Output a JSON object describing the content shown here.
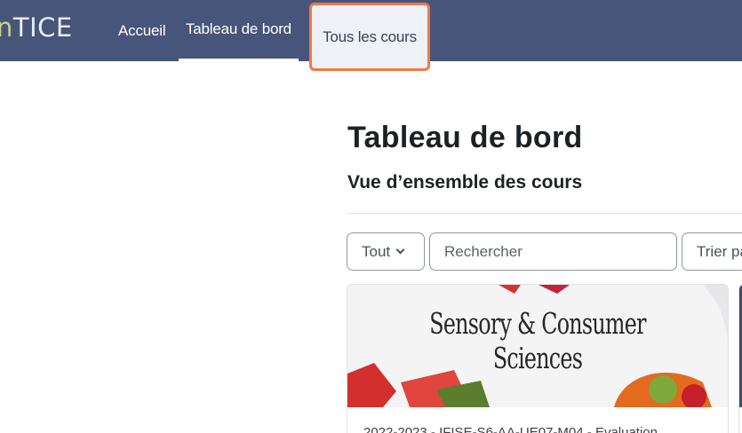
{
  "navbar": {
    "logo_prefix": "n",
    "logo_main": "TICE",
    "items": [
      {
        "label": "Accueil"
      },
      {
        "label": "Tableau de bord"
      },
      {
        "label": "Tous les cours"
      }
    ]
  },
  "main": {
    "page_title": "Tableau de bord",
    "section_title": "Vue d’ensemble des cours",
    "filters": {
      "status_selected": "Tout",
      "search_placeholder": "Rechercher",
      "sort_label": "Trier pa"
    },
    "courses": [
      {
        "image_text": "Sensory & Consumer Sciences",
        "meta": "2022-2023 - IFISE-S6-AA-UE07-M04 - Evaluation"
      }
    ]
  },
  "colors": {
    "navbar_bg": "#48557a",
    "highlight_border": "#ef7a45"
  }
}
